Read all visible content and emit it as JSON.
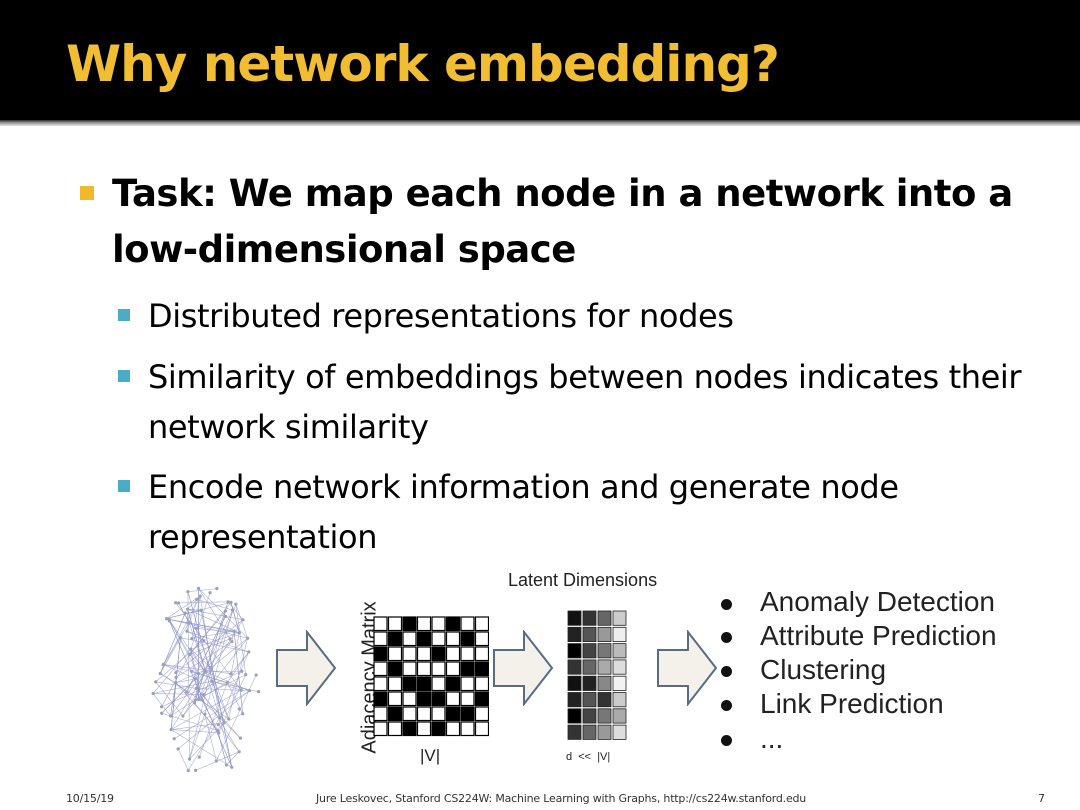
{
  "slide": {
    "title": "Why network embedding?",
    "bullets": [
      {
        "text": "Task: We map each node in a network into a low-dimensional space",
        "sub": [
          "Distributed representations for nodes",
          "Similarity of embeddings between nodes indicates their network similarity",
          "Encode network information and generate node representation"
        ]
      }
    ]
  },
  "figure": {
    "matrix_label": "Adjacency Matrix",
    "matrix_axis": "|V|",
    "latent_label": "Latent Dimensions",
    "latent_axis": "d  <<  |V|",
    "tasks": [
      "Anomaly Detection",
      "Attribute Prediction",
      "Clustering",
      "Link Prediction",
      "..."
    ]
  },
  "footer": {
    "date": "10/15/19",
    "credit": "Jure Leskovec, Stanford CS224W: Machine Learning with Graphs, http://cs224w.stanford.edu",
    "page": "7"
  },
  "colors": {
    "title": "#f1bd33",
    "bullet_l1": "#f0b92b",
    "bullet_l2": "#4bacc6",
    "header_bg": "#000000",
    "graph_edges": "#8a8fc4"
  }
}
